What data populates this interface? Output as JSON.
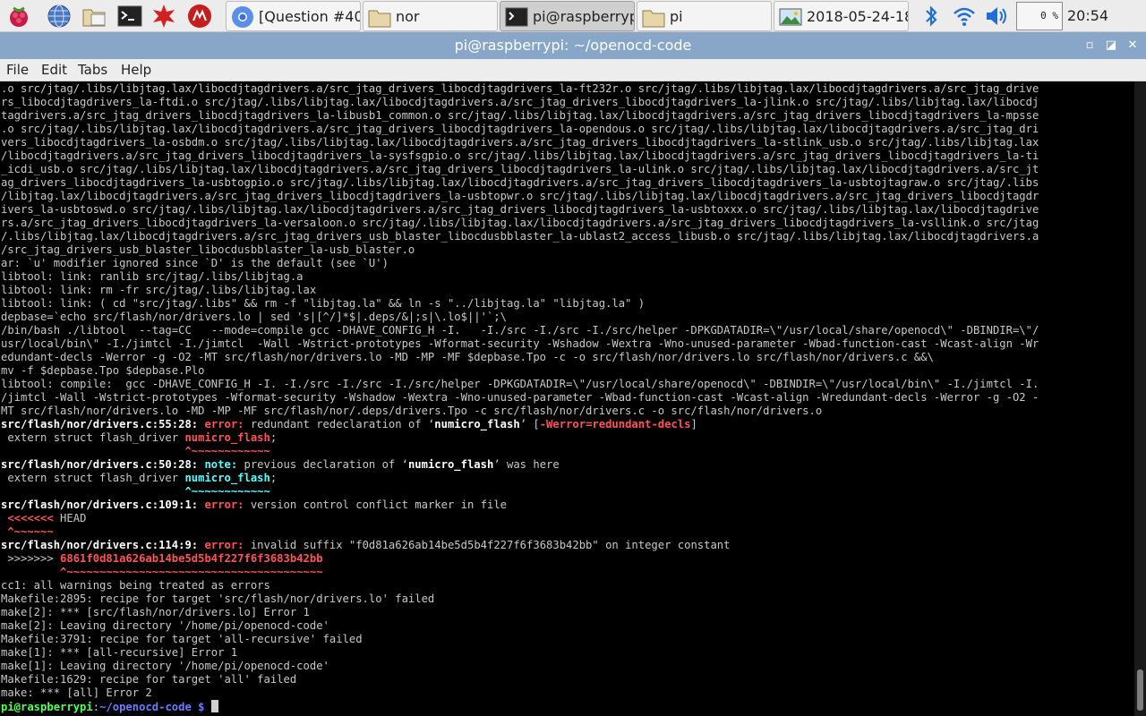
{
  "taskbar": {
    "launchers": [
      "raspberry-menu-icon",
      "globe-browser-icon",
      "file-manager-icon",
      "terminal-icon",
      "math-kernel-icon",
      "wolfram-icon"
    ],
    "tasks": [
      {
        "label": "[Question #40...",
        "icon": "chromium-icon",
        "active": false
      },
      {
        "label": "nor",
        "icon": "folder-icon",
        "active": false
      },
      {
        "label": "pi@raspberryp...",
        "icon": "terminal-icon",
        "active": true
      },
      {
        "label": "pi",
        "icon": "folder-icon",
        "active": false
      },
      {
        "label": "2018-05-24-18...",
        "icon": "image-viewer-icon",
        "active": false
      }
    ],
    "cpu": "0 %",
    "clock": "20:54"
  },
  "window": {
    "title": "pi@raspberrypi: ~/openocd-code",
    "buttons": [
      "minimize",
      "maximize",
      "close"
    ]
  },
  "menu": [
    "File",
    "Edit",
    "Tabs",
    "Help"
  ],
  "terminal": {
    "lines": [
      [
        {
          "t": ".o src/jtag/.libs/libjtag.lax/libocdjtagdrivers.a/src_jtag_drivers_libocdjtagdrivers_la-ft232r.o src/jtag/.libs/libjtag.lax/libocdjtagdrivers.a/src_jtag_drive"
        }
      ],
      [
        {
          "t": "rs_libocdjtagdrivers_la-ftdi.o src/jtag/.libs/libjtag.lax/libocdjtagdrivers.a/src_jtag_drivers_libocdjtagdrivers_la-jlink.o src/jtag/.libs/libjtag.lax/libocdj"
        }
      ],
      [
        {
          "t": "tagdrivers.a/src_jtag_drivers_libocdjtagdrivers_la-libusb1_common.o src/jtag/.libs/libjtag.lax/libocdjtagdrivers.a/src_jtag_drivers_libocdjtagdrivers_la-mpsse"
        }
      ],
      [
        {
          "t": ".o src/jtag/.libs/libjtag.lax/libocdjtagdrivers.a/src_jtag_drivers_libocdjtagdrivers_la-opendous.o src/jtag/.libs/libjtag.lax/libocdjtagdrivers.a/src_jtag_dri"
        }
      ],
      [
        {
          "t": "vers_libocdjtagdrivers_la-osbdm.o src/jtag/.libs/libjtag.lax/libocdjtagdrivers.a/src_jtag_drivers_libocdjtagdrivers_la-stlink_usb.o src/jtag/.libs/libjtag.lax"
        }
      ],
      [
        {
          "t": "/libocdjtagdrivers.a/src_jtag_drivers_libocdjtagdrivers_la-sysfsgpio.o src/jtag/.libs/libjtag.lax/libocdjtagdrivers.a/src_jtag_drivers_libocdjtagdrivers_la-ti"
        }
      ],
      [
        {
          "t": "_icdi_usb.o src/jtag/.libs/libjtag.lax/libocdjtagdrivers.a/src_jtag_drivers_libocdjtagdrivers_la-ulink.o src/jtag/.libs/libjtag.lax/libocdjtagdrivers.a/src_jt"
        }
      ],
      [
        {
          "t": "ag_drivers_libocdjtagdrivers_la-usbtogpio.o src/jtag/.libs/libjtag.lax/libocdjtagdrivers.a/src_jtag_drivers_libocdjtagdrivers_la-usbtojtagraw.o src/jtag/.libs"
        }
      ],
      [
        {
          "t": "/libjtag.lax/libocdjtagdrivers.a/src_jtag_drivers_libocdjtagdrivers_la-usbtopwr.o src/jtag/.libs/libjtag.lax/libocdjtagdrivers.a/src_jtag_drivers_libocdjtagdr"
        }
      ],
      [
        {
          "t": "ivers_la-usbtoswd.o src/jtag/.libs/libjtag.lax/libocdjtagdrivers.a/src_jtag_drivers_libocdjtagdrivers_la-usbtoxxx.o src/jtag/.libs/libjtag.lax/libocdjtagdrive"
        }
      ],
      [
        {
          "t": "rs.a/src_jtag_drivers_libocdjtagdrivers_la-versaloon.o src/jtag/.libs/libjtag.lax/libocdjtagdrivers.a/src_jtag_drivers_libocdjtagdrivers_la-vsllink.o src/jtag"
        }
      ],
      [
        {
          "t": "/.libs/libjtag.lax/libocdjtagdrivers.a/src_jtag_drivers_usb_blaster_libocdusbblaster_la-ublast2_access_libusb.o src/jtag/.libs/libjtag.lax/libocdjtagdrivers.a"
        }
      ],
      [
        {
          "t": "/src_jtag_drivers_usb_blaster_libocdusbblaster_la-usb_blaster.o"
        }
      ],
      [
        {
          "t": "ar: `u' modifier ignored since `D' is the default (see `U')"
        }
      ],
      [
        {
          "t": "libtool: link: ranlib src/jtag/.libs/libjtag.a"
        }
      ],
      [
        {
          "t": "libtool: link: rm -fr src/jtag/.libs/libjtag.lax"
        }
      ],
      [
        {
          "t": "libtool: link: ( cd \"src/jtag/.libs\" && rm -f \"libjtag.la\" && ln -s \"../libjtag.la\" \"libjtag.la\" )"
        }
      ],
      [
        {
          "t": "depbase=`echo src/flash/nor/drivers.lo | sed 's|[^/]*$|.deps/&|;s|\\.lo$||'`;\\"
        }
      ],
      [
        {
          "t": "/bin/bash ./libtool  --tag=CC   --mode=compile gcc -DHAVE_CONFIG_H -I.   -I./src -I./src -I./src/helper -DPKGDATADIR=\\\"/usr/local/share/openocd\\\" -DBINDIR=\\\"/"
        }
      ],
      [
        {
          "t": "usr/local/bin\\\" -I./jimtcl -I./jimtcl  -Wall -Wstrict-prototypes -Wformat-security -Wshadow -Wextra -Wno-unused-parameter -Wbad-function-cast -Wcast-align -Wr"
        }
      ],
      [
        {
          "t": "edundant-decls -Werror -g -O2 -MT src/flash/nor/drivers.lo -MD -MP -MF $depbase.Tpo -c -o src/flash/nor/drivers.lo src/flash/nor/drivers.c &&\\"
        }
      ],
      [
        {
          "t": "mv -f $depbase.Tpo $depbase.Plo"
        }
      ],
      [
        {
          "t": "libtool: compile:  gcc -DHAVE_CONFIG_H -I. -I./src -I./src -I./src/helper -DPKGDATADIR=\\\"/usr/local/share/openocd\\\" -DBINDIR=\\\"/usr/local/bin\\\" -I./jimtcl -I."
        }
      ],
      [
        {
          "t": "/jimtcl -Wall -Wstrict-prototypes -Wformat-security -Wshadow -Wextra -Wno-unused-parameter -Wbad-function-cast -Wcast-align -Wredundant-decls -Werror -g -O2 -"
        }
      ],
      [
        {
          "t": "MT src/flash/nor/drivers.lo -MD -MP -MF src/flash/nor/.deps/drivers.Tpo -c src/flash/nor/drivers.c -o src/flash/nor/drivers.o"
        }
      ],
      [
        {
          "t": "src/flash/nor/drivers.c:55:28: ",
          "c": "b"
        },
        {
          "t": "error: ",
          "c": "err"
        },
        {
          "t": "redundant redeclaration of ‘"
        },
        {
          "t": "numicro_flash",
          "c": "b"
        },
        {
          "t": "’ ["
        },
        {
          "t": "-Werror=redundant-decls",
          "c": "err"
        },
        {
          "t": "]"
        }
      ],
      [
        {
          "t": " extern struct flash_driver "
        },
        {
          "t": "numicro_flash",
          "c": "redb"
        },
        {
          "t": ";"
        }
      ],
      [
        {
          "t": "                            "
        },
        {
          "t": "^~~~~~~~~~~~~",
          "c": "redb"
        }
      ],
      [
        {
          "t": "src/flash/nor/drivers.c:50:28: ",
          "c": "b"
        },
        {
          "t": "note: ",
          "c": "note"
        },
        {
          "t": "previous declaration of ‘"
        },
        {
          "t": "numicro_flash",
          "c": "b"
        },
        {
          "t": "’ was here"
        }
      ],
      [
        {
          "t": " extern struct flash_driver "
        },
        {
          "t": "numicro_flash",
          "c": "cyanb"
        },
        {
          "t": ";"
        }
      ],
      [
        {
          "t": "                            "
        },
        {
          "t": "^~~~~~~~~~~~~",
          "c": "cyanb"
        }
      ],
      [
        {
          "t": "src/flash/nor/drivers.c:109:1: ",
          "c": "b"
        },
        {
          "t": "error: ",
          "c": "err"
        },
        {
          "t": "version control conflict marker in file"
        }
      ],
      [
        {
          "t": " "
        },
        {
          "t": "<<<<<<<",
          "c": "redb"
        },
        {
          "t": " HEAD"
        }
      ],
      [
        {
          "t": " "
        },
        {
          "t": "^~~~~~~",
          "c": "redb"
        }
      ],
      [
        {
          "t": "src/flash/nor/drivers.c:114:9: ",
          "c": "b"
        },
        {
          "t": "error: ",
          "c": "err"
        },
        {
          "t": "invalid suffix \"f0d81a626ab14be5d5b4f227f6f3683b42bb\" on integer constant"
        }
      ],
      [
        {
          "t": " >>>>>>> "
        },
        {
          "t": "6861f0d81a626ab14be5d5b4f227f6f3683b42bb",
          "c": "redb"
        }
      ],
      [
        {
          "t": "         "
        },
        {
          "t": "^~~~~~~~~~~~~~~~~~~~~~~~~~~~~~~~~~~~~~~~",
          "c": "redb"
        }
      ],
      [
        {
          "t": "cc1: all warnings being treated as errors"
        }
      ],
      [
        {
          "t": "Makefile:2895: recipe for target 'src/flash/nor/drivers.lo' failed"
        }
      ],
      [
        {
          "t": "make[2]: *** [src/flash/nor/drivers.lo] Error 1"
        }
      ],
      [
        {
          "t": "make[2]: Leaving directory '/home/pi/openocd-code'"
        }
      ],
      [
        {
          "t": "Makefile:3791: recipe for target 'all-recursive' failed"
        }
      ],
      [
        {
          "t": "make[1]: *** [all-recursive] Error 1"
        }
      ],
      [
        {
          "t": "make[1]: Leaving directory '/home/pi/openocd-code'"
        }
      ],
      [
        {
          "t": "Makefile:1629: recipe for target 'all' failed"
        }
      ],
      [
        {
          "t": "make: *** [all] Error 2"
        }
      ],
      [
        {
          "t": "pi@raspberrypi",
          "c": "green"
        },
        {
          "t": ":"
        },
        {
          "t": "~/openocd-code $",
          "c": "blue"
        },
        {
          "t": " "
        }
      ]
    ]
  }
}
